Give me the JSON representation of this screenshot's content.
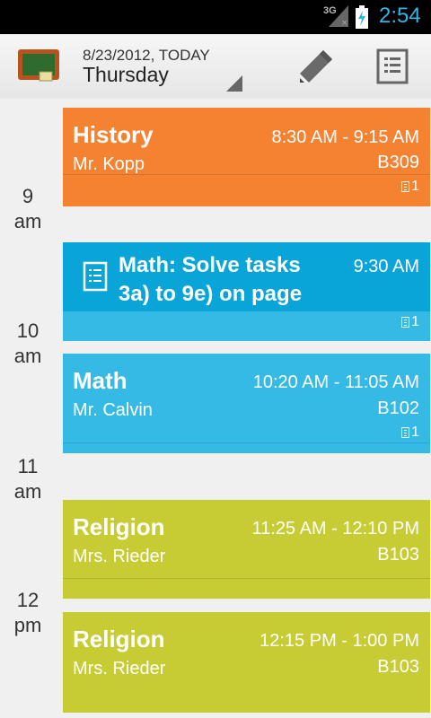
{
  "status_bar": {
    "network": "3G",
    "clock": "2:54",
    "accent_color": "#33b5e5"
  },
  "action_bar": {
    "date": "8/23/2012, TODAY",
    "day": "Thursday",
    "icons": [
      "chalkboard-app-icon",
      "pencil-icon",
      "notes-list-icon"
    ]
  },
  "hours": [
    {
      "hour": "9",
      "suffix": "am"
    },
    {
      "hour": "10",
      "suffix": "am"
    },
    {
      "hour": "11",
      "suffix": "am"
    },
    {
      "hour": "12",
      "suffix": "pm"
    }
  ],
  "events": [
    {
      "title": "History",
      "time": "8:30 AM - 9:15 AM",
      "teacher": "Mr. Kopp",
      "room": "B309",
      "count": "1",
      "color": "#f58231"
    },
    {
      "title": "Math: Solve tasks 3a) to 9e) on page",
      "time": "9:30 AM",
      "count": "1",
      "color": "#0aa5d8"
    },
    {
      "title": "Math",
      "time": "10:20 AM - 11:05 AM",
      "teacher": "Mr. Calvin",
      "room": "B102",
      "count": "1",
      "color": "#35b9e5"
    },
    {
      "title": "Religion",
      "time": "11:25 AM - 12:10 PM",
      "teacher": "Mrs. Rieder",
      "room": "B103",
      "color": "#c8cc34"
    },
    {
      "title": "Religion",
      "time": "12:15 PM - 1:00 PM",
      "teacher": "Mrs. Rieder",
      "room": "B103",
      "color": "#c8cc34"
    }
  ]
}
